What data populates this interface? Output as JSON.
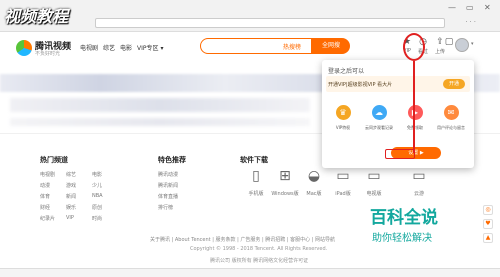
{
  "browser": {
    "title": "视频教程",
    "win_controls": [
      "▭",
      "—",
      "✕"
    ]
  },
  "header": {
    "logo_text": "腾讯视频",
    "logo_sub": "不负好时光",
    "nav": [
      "电视剧",
      "综艺",
      "电影",
      "VIP专区 ▾"
    ],
    "search": {
      "hot": "热搜榜",
      "button": "全网搜"
    },
    "icons": [
      {
        "name": "vip-icon",
        "glyph": "★",
        "label": "VIP"
      },
      {
        "name": "history-icon",
        "glyph": "◷",
        "label": "看过"
      },
      {
        "name": "upload-icon",
        "glyph": "⇪",
        "label": "上传"
      },
      {
        "name": "client-icon",
        "glyph": "▢",
        "label": "打开客户端"
      }
    ]
  },
  "footer": {
    "hot_channels": {
      "title": "热门频道",
      "links": [
        "电视剧",
        "综艺",
        "电影",
        "动漫",
        "游戏",
        "少儿",
        "体育",
        "新闻",
        "NBA",
        "财经",
        "娱乐",
        "原创",
        "纪录片",
        "VIP",
        "时尚"
      ]
    },
    "features": {
      "title": "特色推荐",
      "links": [
        "腾讯动漫",
        "腾讯新闻",
        "体育直播",
        "排行榜"
      ]
    },
    "download": {
      "title": "软件下载",
      "items": [
        {
          "name": "phone",
          "icon": "▯",
          "label": "手机版"
        },
        {
          "name": "windows",
          "icon": "⊞",
          "label": "Windows版"
        },
        {
          "name": "mac",
          "icon": "◒",
          "label": "Mac版"
        },
        {
          "name": "pad",
          "icon": "▭",
          "label": "iPad版"
        },
        {
          "name": "tv",
          "icon": "▭",
          "label": "电视版"
        },
        {
          "name": "laptop",
          "icon": "▭",
          "label": "云游"
        }
      ]
    },
    "links_line": "关于腾讯 | About Tencent | 服务条款 | 广告服务 | 腾讯招聘 | 客服中心 | 网站导航",
    "copyright_1": "Copyright © 1998 - 2018 Tencent. All Rights Reserved.",
    "copyright_2": "腾讯公司 版权所有 腾讯网络文化经营许可证"
  },
  "popup": {
    "login_text": "登录之后可以",
    "vip_text": "开通VIP|超级影视VIP 看大片",
    "vip_button": "开通",
    "features": [
      {
        "name": "vip-rights-icon",
        "glyph": "♛",
        "label": "VIP特权",
        "color": "#f5a623"
      },
      {
        "name": "cloud-sync-icon",
        "glyph": "☁",
        "label": "云同步观看记录",
        "color": "#3fa9f5"
      },
      {
        "name": "skip-ad-icon",
        "glyph": "▶",
        "label": "免费领取",
        "color": "#ff5a5a"
      },
      {
        "name": "message-icon",
        "glyph": "✉",
        "label": "用户评论与留言",
        "color": "#ff8a3d"
      }
    ],
    "settings_button": "设置 ▶"
  },
  "watermark": {
    "line1": "百科全说",
    "line2": "助你轻松解决"
  },
  "right_rail": [
    "◎",
    "♥",
    "▲"
  ]
}
